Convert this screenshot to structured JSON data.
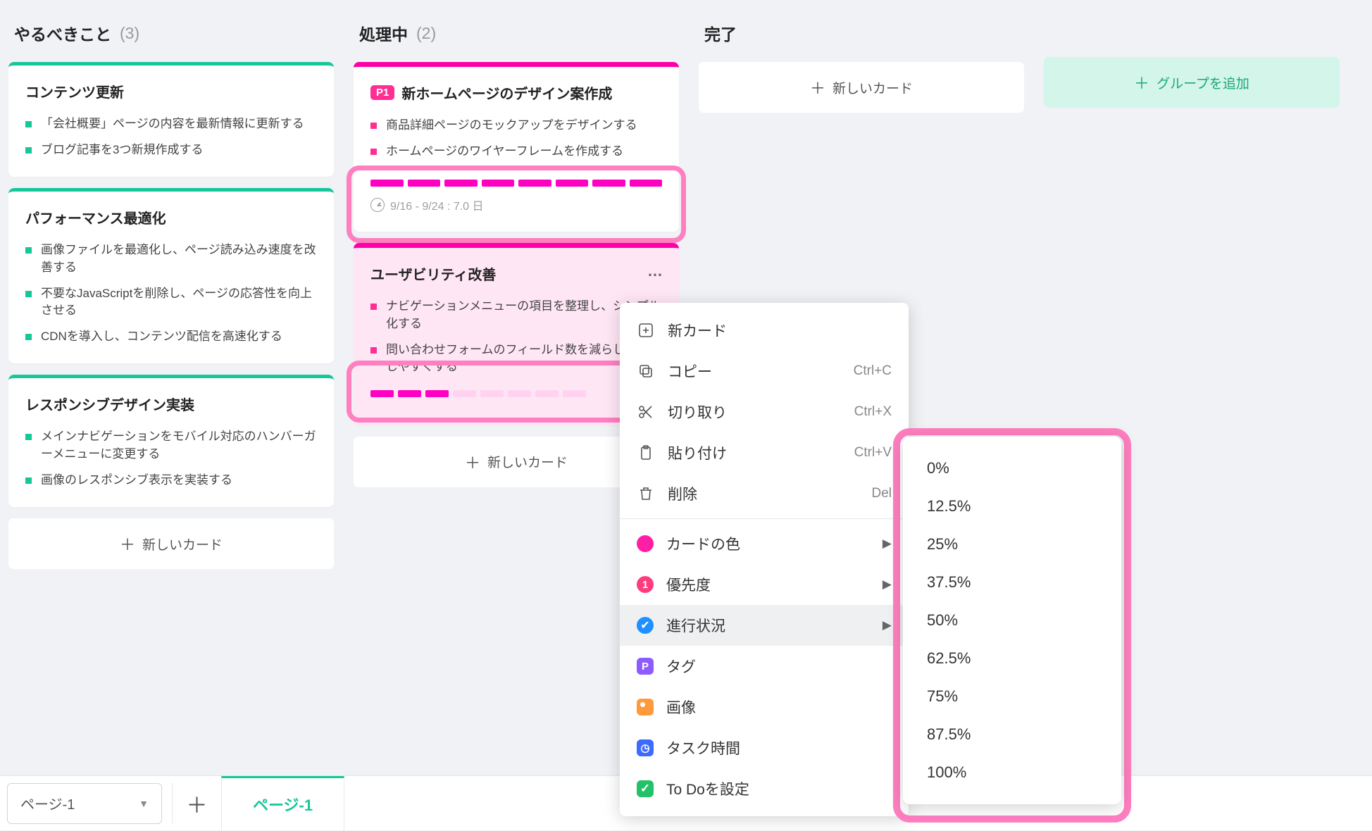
{
  "columns": {
    "todo": {
      "title": "やるべきこと",
      "count": "(3)"
    },
    "doing": {
      "title": "処理中",
      "count": "(2)"
    },
    "done": {
      "title": "完了"
    }
  },
  "cards": {
    "c1": {
      "title": "コンテンツ更新",
      "b1": "「会社概要」ページの内容を最新情報に更新する",
      "b2": "ブログ記事を3つ新規作成する"
    },
    "c2": {
      "title": "パフォーマンス最適化",
      "b1": "画像ファイルを最適化し、ページ読み込み速度を改善する",
      "b2": "不要なJavaScriptを削除し、ページの応答性を向上させる",
      "b3": "CDNを導入し、コンテンツ配信を高速化する"
    },
    "c3": {
      "title": "レスポンシブデザイン実装",
      "b1": "メインナビゲーションをモバイル対応のハンバーガーメニューに変更する",
      "b2": "画像のレスポンシブ表示を実装する"
    },
    "c4": {
      "pri": "P1",
      "title": "新ホームページのデザイン案作成",
      "b1": "商品詳細ページのモックアップをデザインする",
      "b2": "ホームページのワイヤーフレームを作成する",
      "date": "9/16 - 9/24 : 7.0 日"
    },
    "c5": {
      "title": "ユーザビリティ改善",
      "b1": "ナビゲーションメニューの項目を整理し、シンプル化する",
      "b2": "問い合わせフォームのフィールド数を減らし、入力しやすくする"
    }
  },
  "buttons": {
    "new_card": "新しいカード",
    "add_group": "グループを追加"
  },
  "ctx": {
    "new_card": "新カード",
    "copy": "コピー",
    "copy_k": "Ctrl+C",
    "cut": "切り取り",
    "cut_k": "Ctrl+X",
    "paste": "貼り付け",
    "paste_k": "Ctrl+V",
    "delete": "削除",
    "delete_k": "Del",
    "color": "カードの色",
    "priority": "優先度",
    "progress": "進行状況",
    "tag": "タグ",
    "image": "画像",
    "tasktime": "タスク時間",
    "todo": "To Doを設定",
    "pri_num": "1"
  },
  "progress_opts": {
    "p0": "0%",
    "p1": "12.5%",
    "p2": "25%",
    "p3": "37.5%",
    "p4": "50%",
    "p5": "62.5%",
    "p6": "75%",
    "p7": "87.5%",
    "p8": "100%"
  },
  "footer": {
    "page_sel": "ページ-1",
    "tab": "ページ-1"
  }
}
